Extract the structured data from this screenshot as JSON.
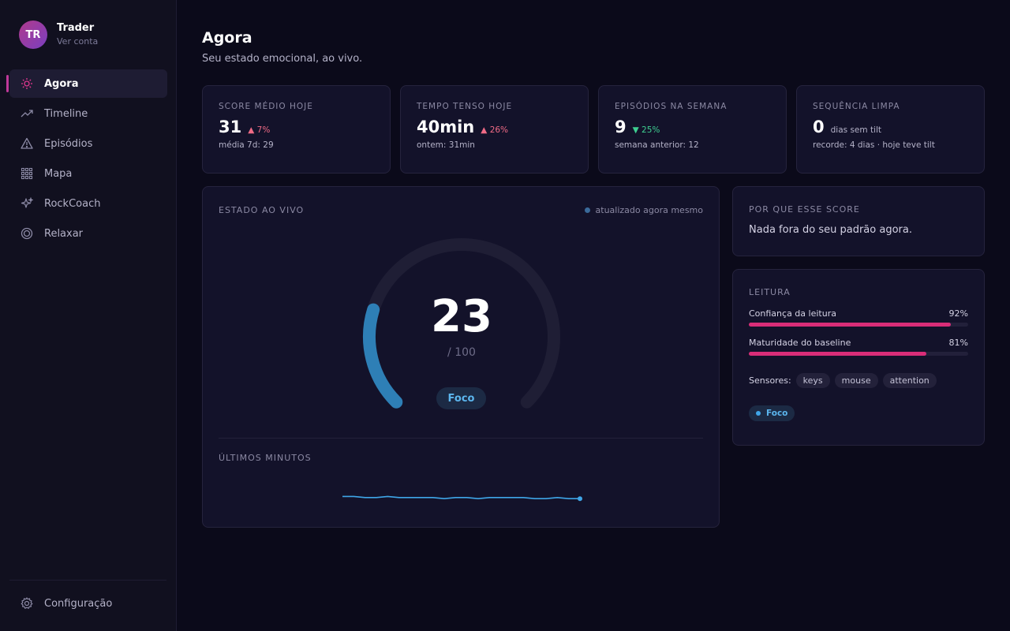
{
  "profile": {
    "initials": "TR",
    "name": "Trader",
    "link": "Ver conta"
  },
  "nav": [
    {
      "label": "Agora",
      "icon": "sun-icon",
      "active": true
    },
    {
      "label": "Timeline",
      "icon": "trend-icon",
      "active": false
    },
    {
      "label": "Episódios",
      "icon": "warning-icon",
      "active": false
    },
    {
      "label": "Mapa",
      "icon": "grid-icon",
      "active": false
    },
    {
      "label": "RockCoach",
      "icon": "sparkle-icon",
      "active": false
    },
    {
      "label": "Relaxar",
      "icon": "target-icon",
      "active": false
    }
  ],
  "settings": {
    "label": "Configuração",
    "icon": "gear-icon"
  },
  "page": {
    "title": "Agora",
    "subtitle": "Seu estado emocional, ao vivo."
  },
  "stats": [
    {
      "label": "Score médio hoje",
      "value": "31",
      "delta": "7%",
      "direction": "up",
      "foot": "média 7d: 29"
    },
    {
      "label": "Tempo tenso hoje",
      "value": "40min",
      "delta": "26%",
      "direction": "up",
      "foot": "ontem: 31min"
    },
    {
      "label": "Episódios na semana",
      "value": "9",
      "delta": "25%",
      "direction": "down",
      "foot": "semana anterior: 12"
    },
    {
      "label": "Sequência limpa",
      "value": "0",
      "unit": "dias sem tilt",
      "foot": "recorde: 4 dias · hoje teve tilt"
    }
  ],
  "live": {
    "label": "Estado ao vivo",
    "updated": "atualizado agora mesmo",
    "score": 23,
    "score_text": "23",
    "max_text": "/ 100",
    "state": "Foco",
    "minutes_label": "Últimos minutos",
    "sparkline": [
      24,
      24,
      23,
      23,
      24,
      23,
      23,
      23,
      23,
      22,
      23,
      23,
      22,
      23,
      23,
      23,
      23,
      22,
      22,
      23,
      22,
      22
    ]
  },
  "why": {
    "label": "Por que esse score",
    "text": "Nada fora do seu padrão agora."
  },
  "reading": {
    "label": "Leitura",
    "metrics": [
      {
        "label": "Confiança da leitura",
        "value_text": "92%",
        "value": 92
      },
      {
        "label": "Maturidade do baseline",
        "value_text": "81%",
        "value": 81
      }
    ],
    "sensors_label": "Sensores:",
    "sensors": [
      "keys",
      "mouse",
      "attention"
    ],
    "state": "Foco"
  },
  "colors": {
    "accent": "#d92d78",
    "focus": "#3fa6e8",
    "up": "#f06b86",
    "down": "#3ecf91"
  }
}
